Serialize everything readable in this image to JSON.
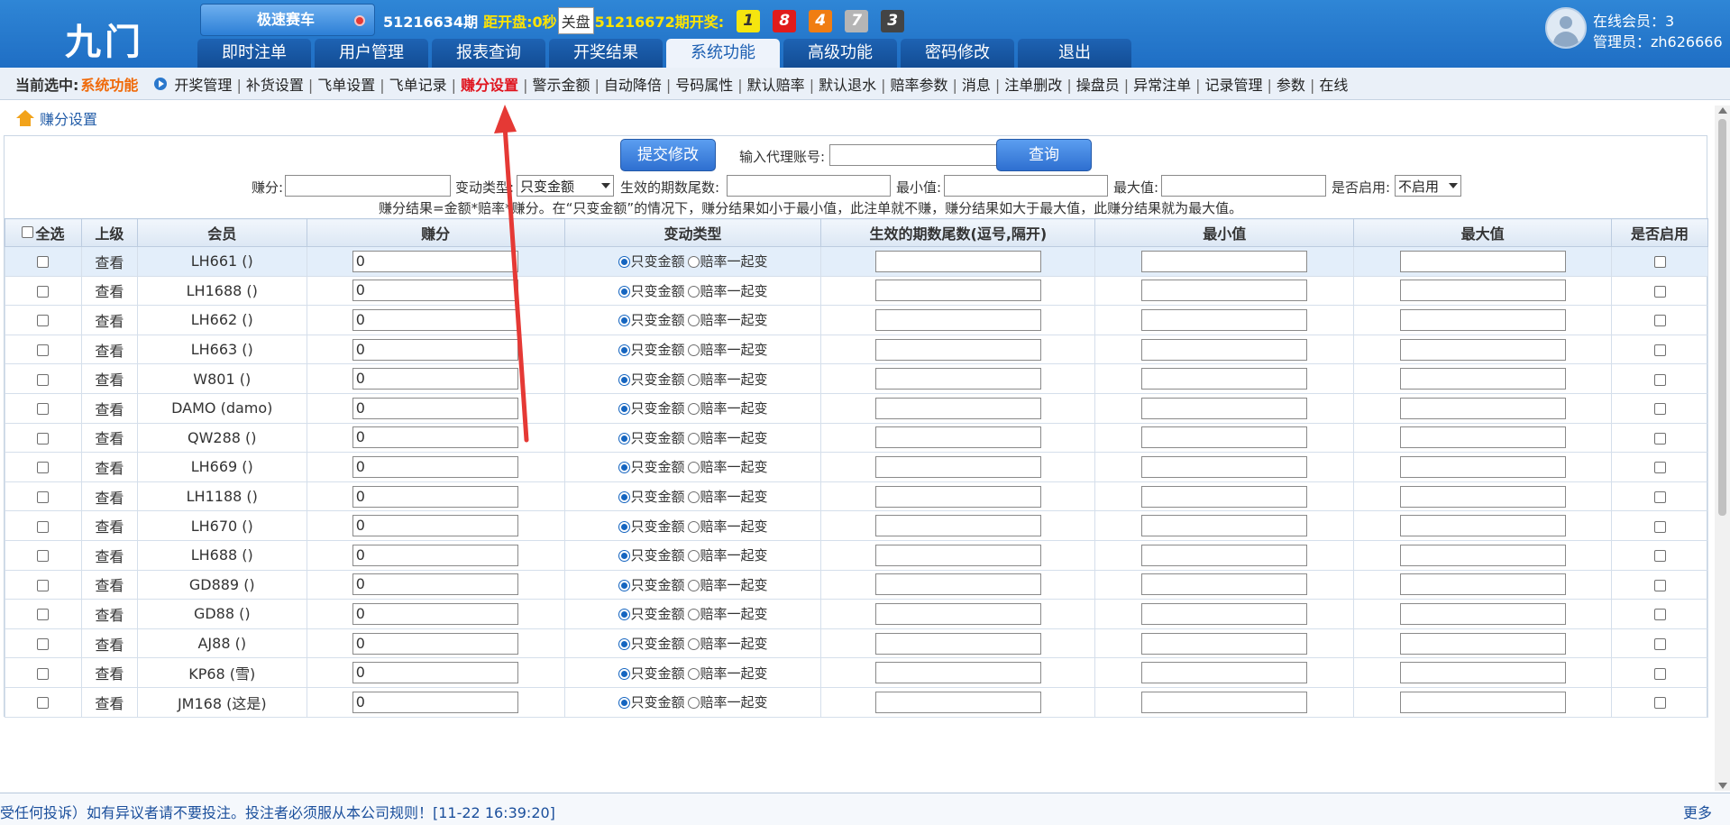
{
  "header": {
    "logo": "九门",
    "game": "极速赛车",
    "issue": "51216634期",
    "countdown": "距开盘:0秒",
    "close_label": "关盘",
    "draw_issue": "51216672期开奖:",
    "balls": [
      {
        "n": "1",
        "bg": "#f5e50f",
        "fg": "#333333"
      },
      {
        "n": "8",
        "bg": "#e11b1b",
        "fg": "#ffffff"
      },
      {
        "n": "4",
        "bg": "#f07d12",
        "fg": "#ffffff"
      },
      {
        "n": "7",
        "bg": "#b5b5b5",
        "fg": "#ffffff"
      },
      {
        "n": "3",
        "bg": "#444444",
        "fg": "#ffffff"
      }
    ],
    "online": "在线会员：3",
    "admin": "管理员：zh626666"
  },
  "nav": [
    "即时注单",
    "用户管理",
    "报表查询",
    "开奖结果",
    "系统功能",
    "高级功能",
    "密码修改",
    "退出"
  ],
  "nav_active": 4,
  "subnav": {
    "current_label": "当前选中:",
    "current_value": "系统功能",
    "items": [
      "开奖管理",
      "补货设置",
      "飞单设置",
      "飞单记录",
      "赚分设置",
      "警示金额",
      "自动降倍",
      "号码属性",
      "默认赔率",
      "默认退水",
      "赔率参数",
      "消息",
      "注单删改",
      "操盘员",
      "异常注单",
      "记录管理",
      "参数",
      "在线"
    ],
    "active": 4
  },
  "breadcrumb": "赚分设置",
  "form": {
    "submit_label": "提交修改",
    "agent_label": "输入代理账号:",
    "agent_value": "",
    "query_label": "查询",
    "score_label": "赚分:",
    "type_label": "变动类型:",
    "type_value": "只变金额",
    "tail_label": "生效的期数尾数:",
    "min_label": "最小值:",
    "max_label": "最大值:",
    "enable_label": "是否启用:",
    "enable_value": "不启用",
    "formula": "赚分结果=金额*赔率*赚分。在“只变金额”的情况下，赚分结果如小于最小值，此注单就不赚，赚分结果如大于最大值，此赚分结果就为最大值。"
  },
  "table": {
    "headers": [
      "全选",
      "上级",
      "会员",
      "赚分",
      "变动类型",
      "生效的期数尾数(逗号,隔开)",
      "最小值",
      "最大值",
      "是否启用"
    ],
    "view_label": "查看",
    "radio1": "只变金额",
    "radio2": "赔率一起变",
    "rows": [
      {
        "member": "LH661 ()",
        "score": "0"
      },
      {
        "member": "LH1688 ()",
        "score": "0"
      },
      {
        "member": "LH662 ()",
        "score": "0"
      },
      {
        "member": "LH663 ()",
        "score": "0"
      },
      {
        "member": "W801 ()",
        "score": "0"
      },
      {
        "member": "DAMO (damo)",
        "score": "0"
      },
      {
        "member": "QW288 ()",
        "score": "0"
      },
      {
        "member": "LH669 ()",
        "score": "0"
      },
      {
        "member": "LH1188 ()",
        "score": "0"
      },
      {
        "member": "LH670 ()",
        "score": "0"
      },
      {
        "member": "LH688 ()",
        "score": "0"
      },
      {
        "member": "GD889 ()",
        "score": "0"
      },
      {
        "member": "GD88 ()",
        "score": "0"
      },
      {
        "member": "AJ88 ()",
        "score": "0"
      },
      {
        "member": "KP68 (雪)",
        "score": "0"
      },
      {
        "member": "JM168 (这是)",
        "score": "0"
      }
    ]
  },
  "footer": {
    "marquee": "受任何投诉）如有异议者请不要投注。投注者必须服从本公司规则！[11-22 16:39:20]",
    "more": "更多"
  },
  "annotation_color": "#e53935"
}
